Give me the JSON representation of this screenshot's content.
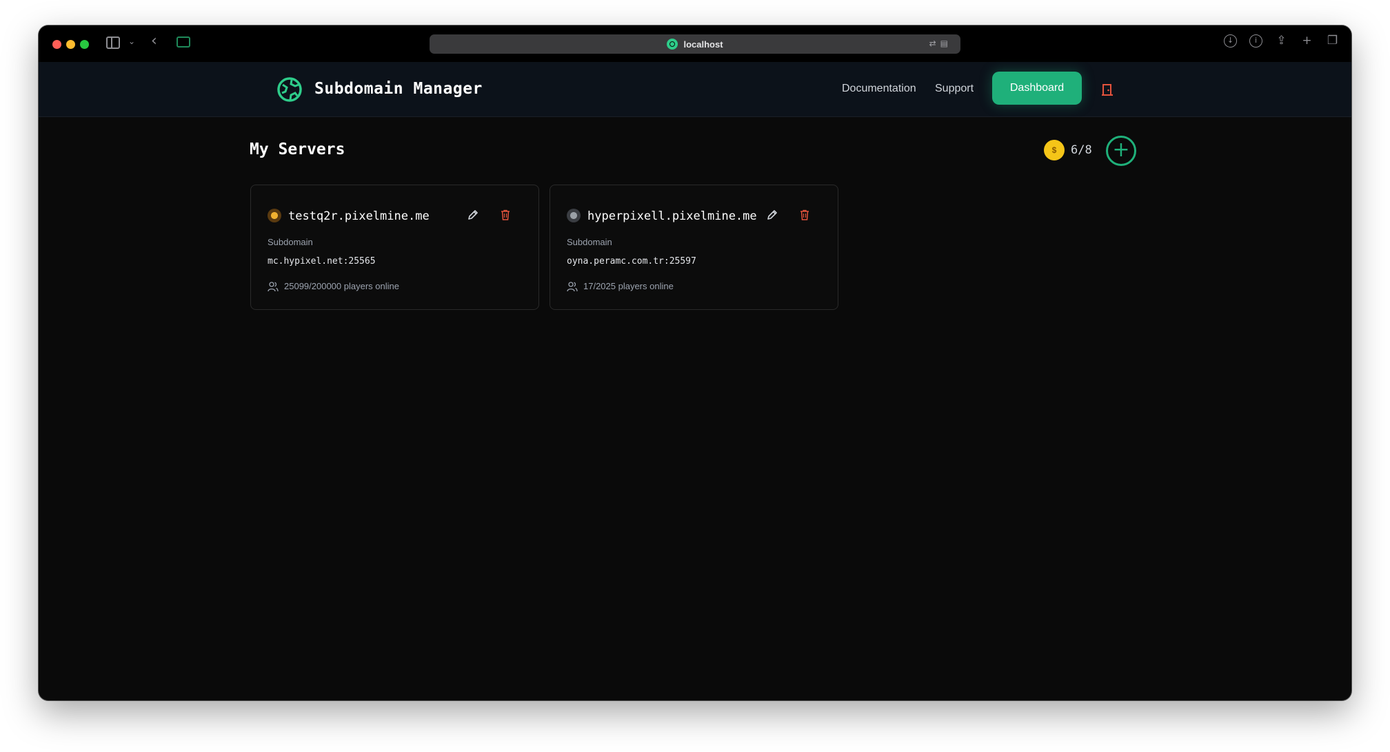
{
  "browser": {
    "url": "localhost"
  },
  "header": {
    "brand": "Subdomain Manager",
    "nav": {
      "documentation": "Documentation",
      "support": "Support",
      "dashboard": "Dashboard"
    }
  },
  "main": {
    "title": "My Servers",
    "coin_symbol": "$",
    "quota": "6/8",
    "add_symbol": "+",
    "servers": [
      {
        "name": "testq2r.pixelmine.me",
        "subdomain_label": "Subdomain",
        "address": "mc.hypixel.net:25565",
        "players": "25099/200000 players online"
      },
      {
        "name": "hyperpixell.pixelmine.me",
        "subdomain_label": "Subdomain",
        "address": "oyna.peramc.com.tr:25597",
        "players": "17/2025 players online"
      }
    ]
  },
  "colors": {
    "accent": "#1fb07a",
    "danger": "#e5533d",
    "coin": "#f5c518"
  }
}
